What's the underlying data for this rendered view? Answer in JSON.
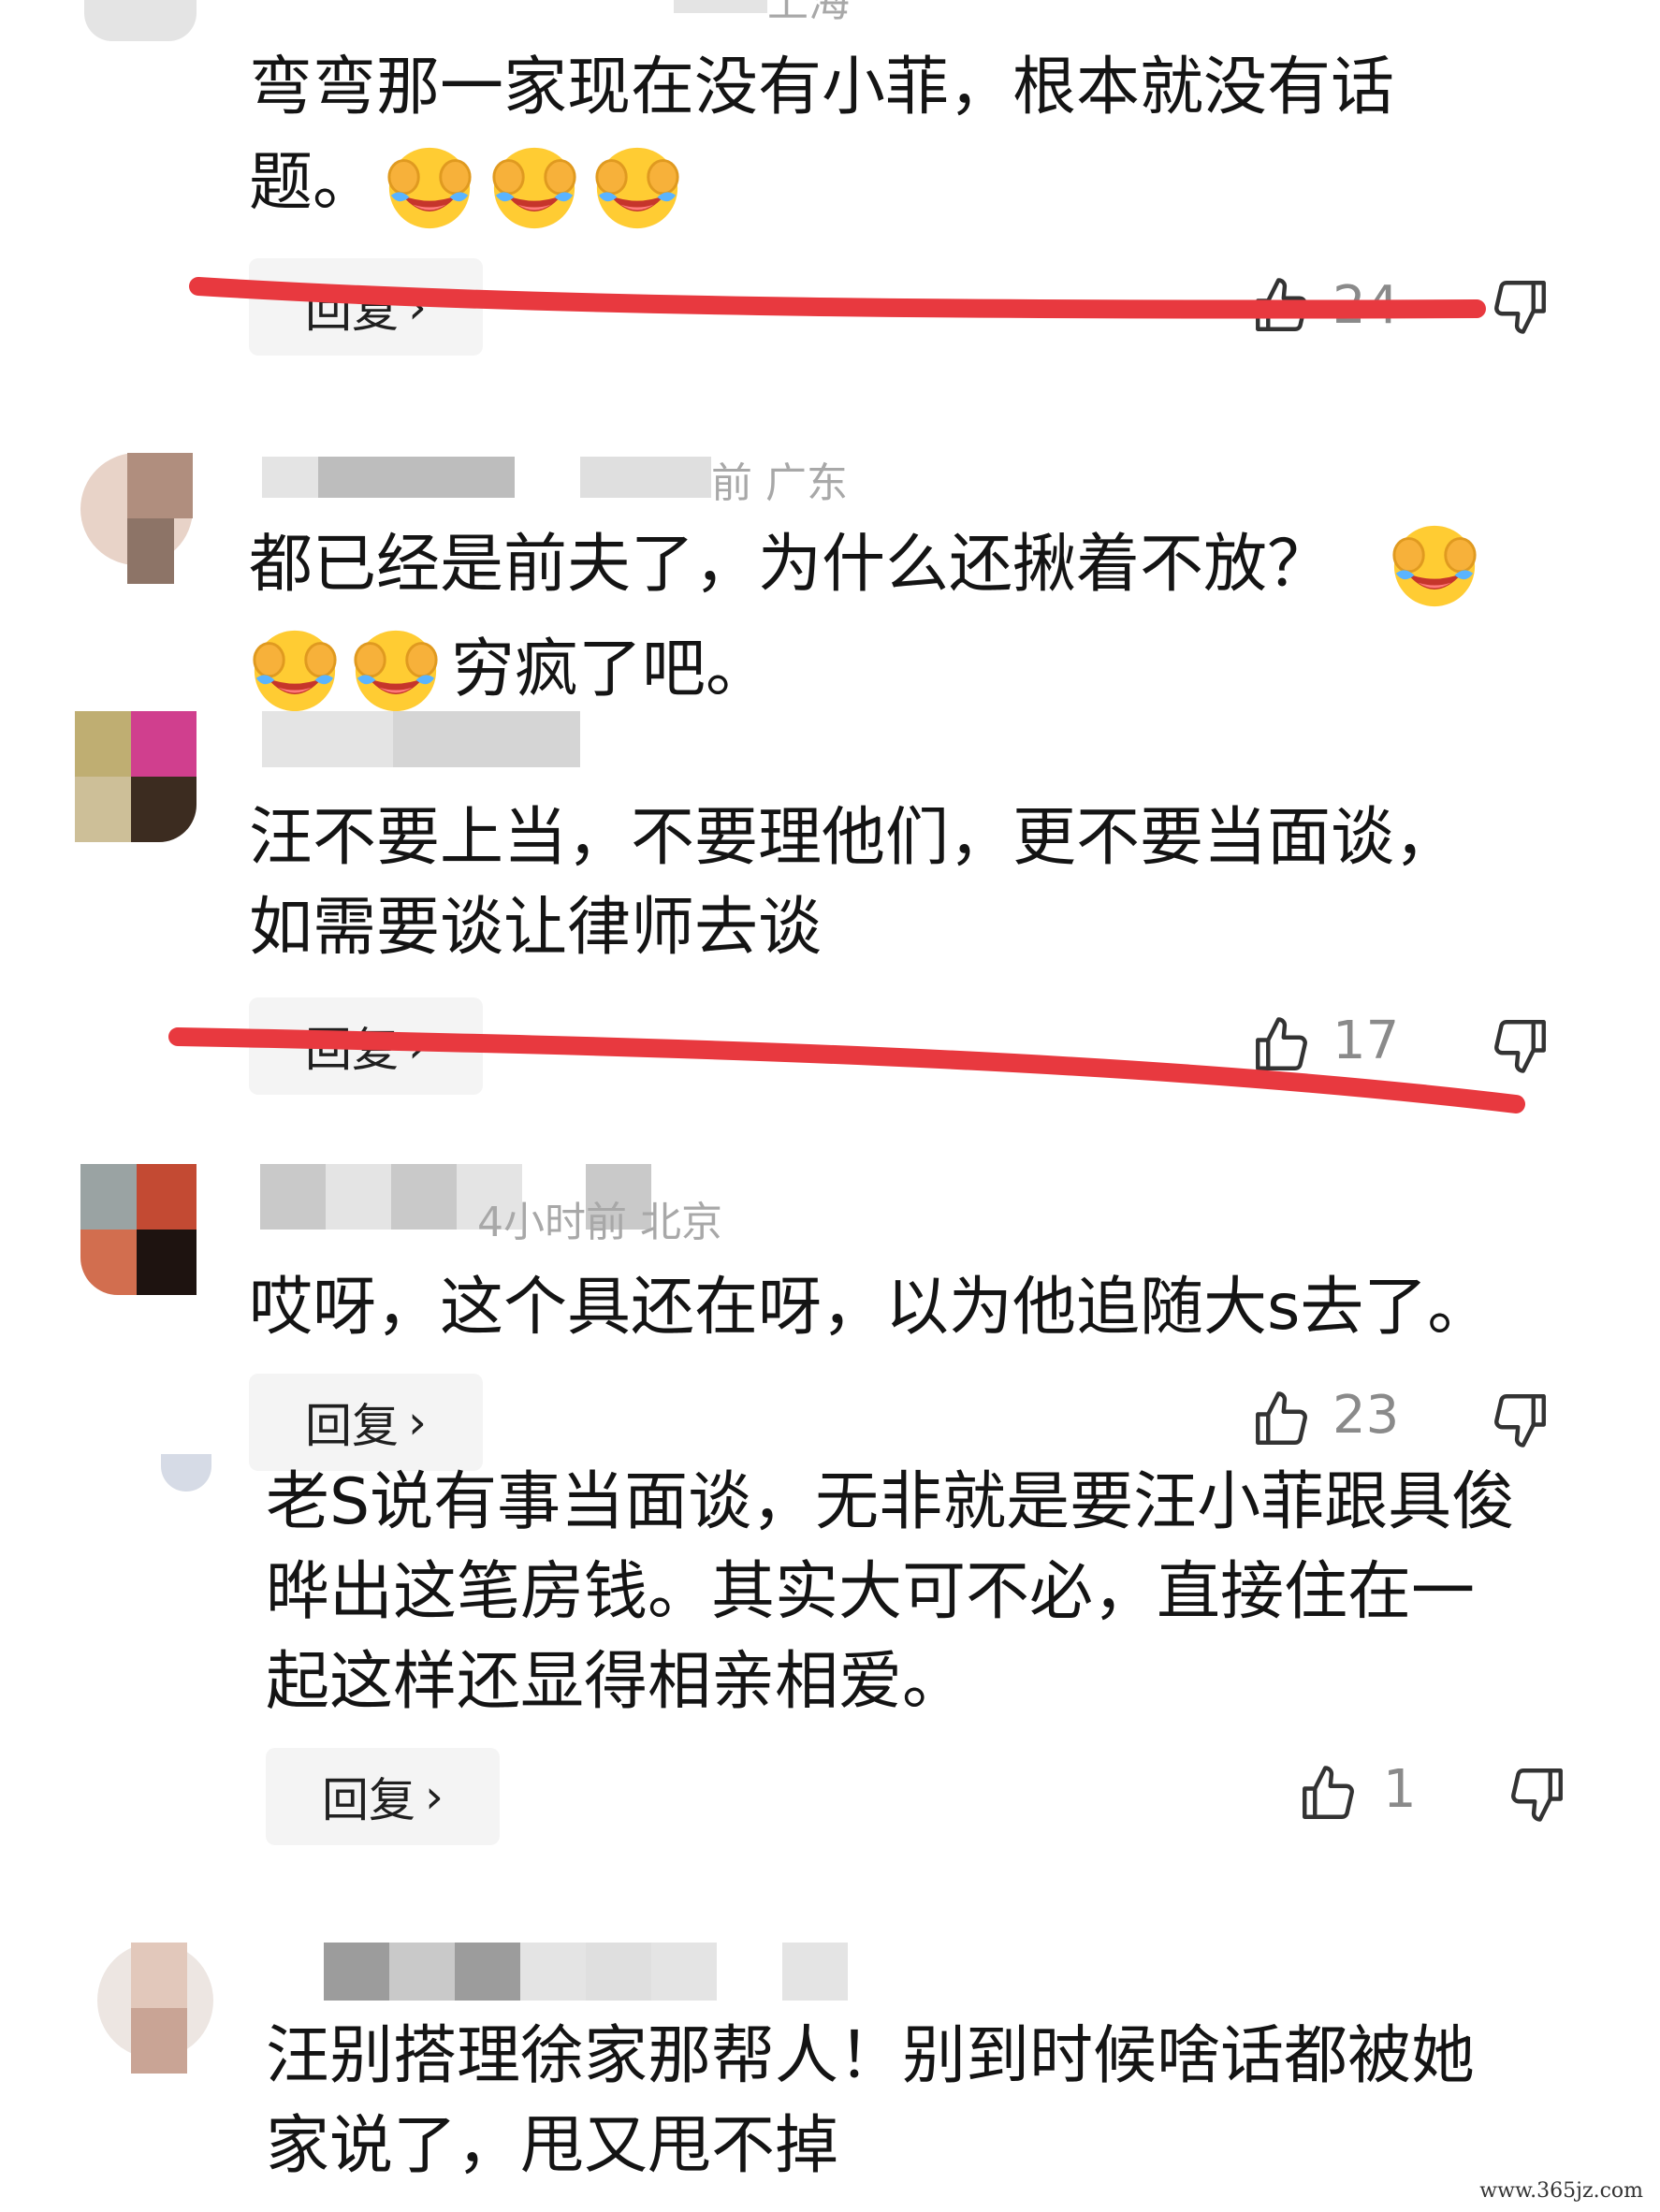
{
  "comments": [
    {
      "meta": "上海",
      "text_lines": [
        "弯弯那一家现在没有小菲，根本就没有话",
        "题。"
      ],
      "reply_label": "回复",
      "likes": "24"
    },
    {
      "meta": "前 广东",
      "text_lines": [
        "都已经是前夫了，为什么还揪着不放？",
        "穷疯了吧。"
      ]
    },
    {
      "meta": "",
      "text_lines": [
        "汪不要上当，不要理他们，更不要当面谈，",
        "如需要谈让律师去谈"
      ],
      "reply_label": "回复",
      "likes": "17"
    },
    {
      "meta": "4小时前 北京",
      "text_lines": [
        "哎呀，这个具还在呀，以为他追随大s去了。"
      ],
      "reply_label": "回复",
      "likes": "23"
    },
    {
      "meta": "",
      "text_lines": [
        "老S说有事当面谈，无非就是要汪小菲跟具俊",
        "晔出这笔房钱。其实大可不必，直接住在一",
        "起这样还显得相亲相爱。"
      ],
      "reply_label": "回复",
      "likes": "1"
    },
    {
      "meta": "",
      "text_lines": [
        "汪别搭理徐家那帮人！别到时候啥话都被她",
        "家说了，甩又甩不掉"
      ]
    }
  ],
  "icons": {
    "like": "thumbs-up-icon",
    "dislike": "thumbs-down-icon",
    "emoji": "rolling-laughing-emoji",
    "chevron": "chevron-right-icon"
  },
  "colors": {
    "strike": "#e8393f",
    "reply_bg": "#f4f4f4",
    "meta": "#a8a8a8"
  },
  "watermark": "www.365jz.com"
}
